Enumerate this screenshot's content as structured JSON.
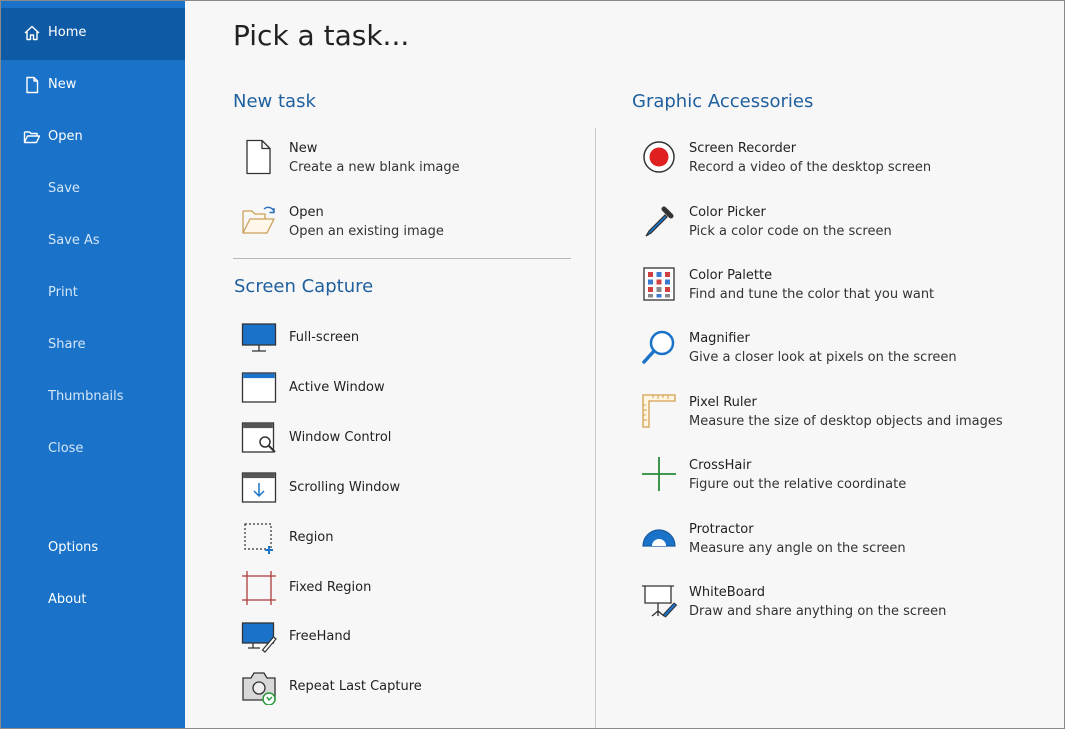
{
  "sidebar": {
    "accent": "#1a73c9",
    "active_bg": "#0e5aa5",
    "items": [
      {
        "label": "Home",
        "icon": "home-icon"
      },
      {
        "label": "New",
        "icon": "file-icon"
      },
      {
        "label": "Open",
        "icon": "folder-open-icon"
      },
      {
        "label": "Save"
      },
      {
        "label": "Save As"
      },
      {
        "label": "Print"
      },
      {
        "label": "Share"
      },
      {
        "label": "Thumbnails"
      },
      {
        "label": "Close"
      },
      {
        "label": "Options"
      },
      {
        "label": "About"
      }
    ]
  },
  "main": {
    "title": "Pick a task...",
    "new_task": {
      "title": "New task",
      "items": [
        {
          "name": "New",
          "desc": "Create a new blank image",
          "icon": "blank-page-icon"
        },
        {
          "name": "Open",
          "desc": "Open an existing image",
          "icon": "folder-open-icon"
        }
      ]
    },
    "screen_capture": {
      "title": "Screen Capture",
      "items": [
        {
          "name": "Full-screen",
          "icon": "monitor-icon"
        },
        {
          "name": "Active Window",
          "icon": "window-icon"
        },
        {
          "name": "Window Control",
          "icon": "window-magnifier-icon"
        },
        {
          "name": "Scrolling Window",
          "icon": "scrolling-window-icon"
        },
        {
          "name": "Region",
          "icon": "region-icon"
        },
        {
          "name": "Fixed Region",
          "icon": "fixed-region-icon"
        },
        {
          "name": "FreeHand",
          "icon": "freehand-icon"
        },
        {
          "name": "Repeat Last Capture",
          "icon": "camera-repeat-icon"
        }
      ]
    },
    "graphic_accessories": {
      "title": "Graphic Accessories",
      "items": [
        {
          "name": "Screen Recorder",
          "desc": "Record a video of the desktop screen",
          "icon": "record-icon"
        },
        {
          "name": "Color Picker",
          "desc": "Pick a color code on the screen",
          "icon": "eyedropper-icon"
        },
        {
          "name": "Color Palette",
          "desc": "Find and tune the color that you want",
          "icon": "palette-icon"
        },
        {
          "name": "Magnifier",
          "desc": "Give a closer look at pixels on the screen",
          "icon": "magnifier-icon"
        },
        {
          "name": "Pixel Ruler",
          "desc": "Measure the size of desktop objects and images",
          "icon": "ruler-icon"
        },
        {
          "name": "CrossHair",
          "desc": "Figure out the relative coordinate",
          "icon": "crosshair-icon"
        },
        {
          "name": "Protractor",
          "desc": "Measure any angle on the screen",
          "icon": "protractor-icon"
        },
        {
          "name": "WhiteBoard",
          "desc": "Draw and share anything on the screen",
          "icon": "whiteboard-icon"
        }
      ]
    }
  }
}
